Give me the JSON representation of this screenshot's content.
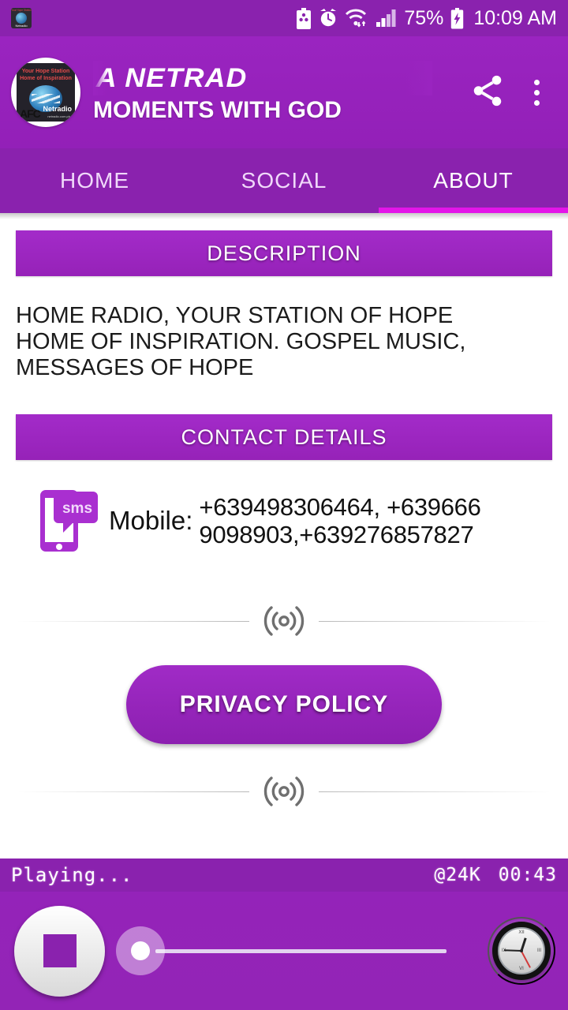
{
  "status_bar": {
    "app_icon_title_line1": "Your Hope Station",
    "app_icon_title_line2": "Home of Inspiration",
    "app_icon_label": "Netradio",
    "battery_saver_icon": "battery-saver-icon",
    "alarm_icon": "alarm-icon",
    "wifi_icon": "wifi-icon",
    "signal_icon": "cell-signal-icon",
    "battery_percent": "75%",
    "battery_icon": "battery-charging-icon",
    "time": "10:09 AM"
  },
  "toolbar": {
    "logo": {
      "line1": "Your Hope Station",
      "line2": "Home of Inspiration",
      "brand": "Netradio",
      "mark": "AFC",
      "url": "netradio.com.ph"
    },
    "marquee_title": "LA             NETRAD",
    "subtitle": "MOMENTS WITH GOD",
    "share_icon": "share-icon",
    "overflow_icon": "overflow-menu-icon"
  },
  "tabs": {
    "items": [
      {
        "label": "HOME",
        "active": false
      },
      {
        "label": "SOCIAL",
        "active": false
      },
      {
        "label": "ABOUT",
        "active": true
      }
    ],
    "active_indicator_color": "#E316E8"
  },
  "main": {
    "description_header": "DESCRIPTION",
    "description_lines": [
      "HOME RADIO, YOUR STATION OF HOPE",
      "HOME OF INSPIRATION. GOSPEL MUSIC,",
      "MESSAGES OF HOPE"
    ],
    "contact_header": "CONTACT DETAILS",
    "contact": {
      "icon": "sms-icon",
      "icon_text": "sms",
      "label": "Mobile:",
      "value_lines": [
        "+639498306464, +639666",
        "9098903,+639276857827"
      ]
    },
    "divider_icon": "broadcast-waves-icon",
    "privacy_button": "PRIVACY POLICY"
  },
  "player": {
    "status_text": "Playing...",
    "bitrate": "@24K",
    "elapsed": "00:43",
    "stop_button": "stop-button",
    "slider": {
      "name": "volume-slider",
      "value": 0
    },
    "sleep_timer_icon": "clock-icon"
  },
  "colors": {
    "primary_purple": "#9320B8",
    "status_bar_purple": "#8A22AE",
    "accent_magenta": "#E316E8",
    "section_header_purple": "#A32BC9"
  }
}
